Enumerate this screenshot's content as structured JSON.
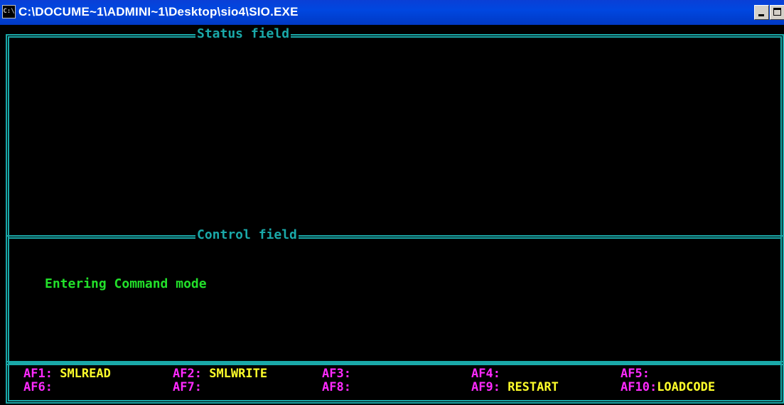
{
  "window": {
    "icon_label": "C:\\",
    "title": "C:\\DOCUME~1\\ADMINI~1\\Desktop\\sio4\\SIO.EXE"
  },
  "panels": {
    "status_title": "Status field",
    "control_title": "Control field"
  },
  "control": {
    "message": "Entering Command mode"
  },
  "function_keys": [
    {
      "key": "AF1:",
      "label": "SMLREAD"
    },
    {
      "key": "AF2:",
      "label": "SMLWRITE"
    },
    {
      "key": "AF3:",
      "label": ""
    },
    {
      "key": "AF4:",
      "label": ""
    },
    {
      "key": "AF5:",
      "label": ""
    },
    {
      "key": "AF6:",
      "label": ""
    },
    {
      "key": "AF7:",
      "label": ""
    },
    {
      "key": "AF8:",
      "label": ""
    },
    {
      "key": "AF9:",
      "label": "RESTART"
    },
    {
      "key": "AF10:",
      "label": "LOADCODE"
    }
  ],
  "colors": {
    "frame": "#1aa9a9",
    "message": "#22e02a",
    "key": "#ff2aff",
    "label": "#ffff2a",
    "titlebar": "#0047e0"
  }
}
